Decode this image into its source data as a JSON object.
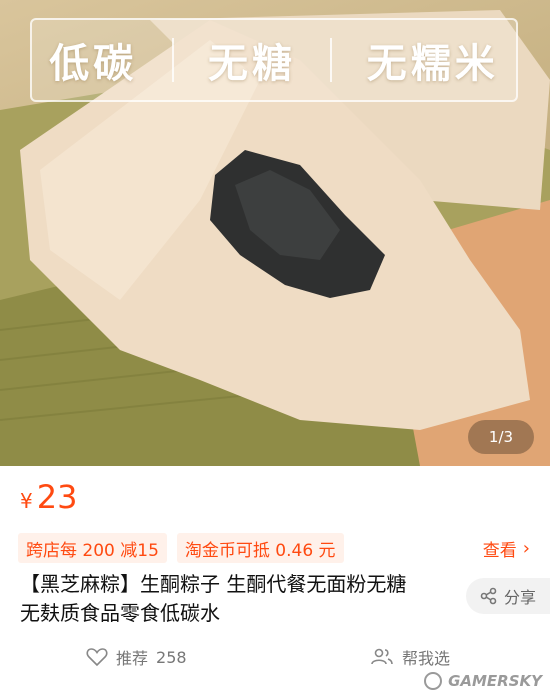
{
  "hero": {
    "banner_words": [
      "低碳",
      "无糖",
      "无糯米"
    ],
    "image_counter": "1/3"
  },
  "price": {
    "currency": "¥",
    "value": "23"
  },
  "promos": {
    "tags": [
      "跨店每 200 减15",
      "淘金币可抵 0.46 元"
    ],
    "view_label": "查看"
  },
  "product": {
    "title_line1": "【黑芝麻粽】生酮粽子 生酮代餐无面粉无糖",
    "title_line2": "无麸质食品零食低碳水"
  },
  "share": {
    "label": "分享"
  },
  "actions": {
    "recommend_label": "推荐",
    "recommend_count": "258",
    "help_choose_label": "帮我选"
  },
  "watermark": {
    "text": "GAMERSKY"
  },
  "colors": {
    "accent": "#ff4a11",
    "tag_bg": "#fff1ea"
  }
}
